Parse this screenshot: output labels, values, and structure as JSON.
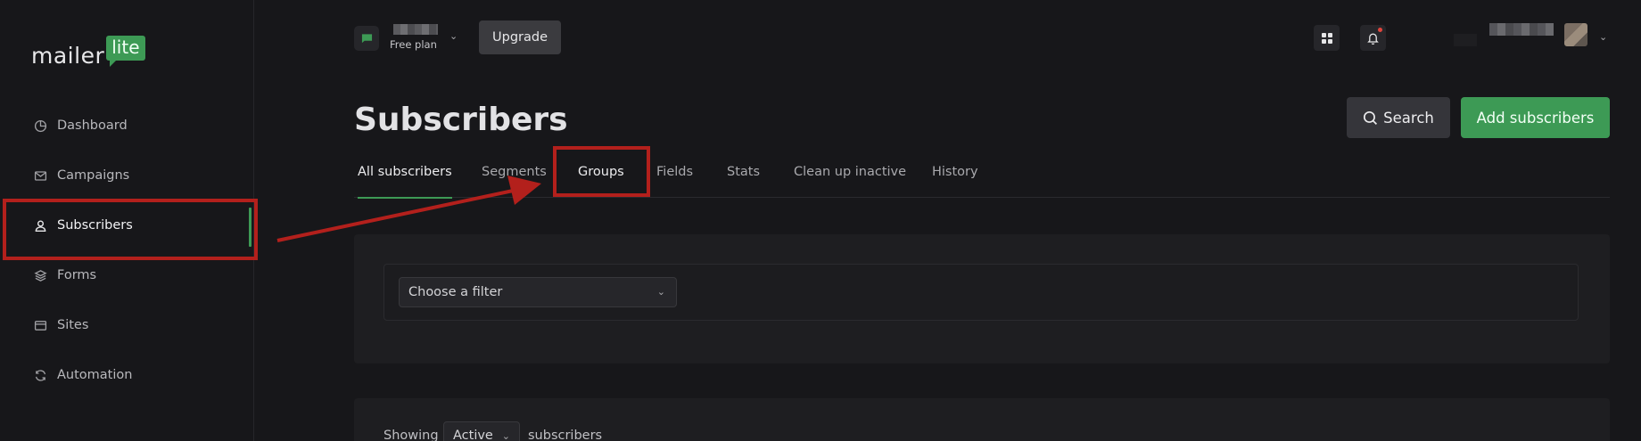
{
  "brand": {
    "word": "mailer",
    "badge": "lite",
    "accent": "#3d9a55"
  },
  "sidebar": {
    "items": [
      {
        "label": "Dashboard",
        "icon": "dashboard-icon"
      },
      {
        "label": "Campaigns",
        "icon": "mail-icon"
      },
      {
        "label": "Subscribers",
        "icon": "user-icon",
        "active": true
      },
      {
        "label": "Forms",
        "icon": "layers-icon"
      },
      {
        "label": "Sites",
        "icon": "browser-icon"
      },
      {
        "label": "Automation",
        "icon": "refresh-icon"
      }
    ]
  },
  "topbar": {
    "plan": "Free plan",
    "upgrade_label": "Upgrade"
  },
  "page": {
    "title": "Subscribers",
    "search_label": "Search",
    "add_label": "Add subscribers"
  },
  "tabs": [
    {
      "label": "All subscribers",
      "active": true
    },
    {
      "label": "Segments"
    },
    {
      "label": "Groups",
      "highlighted": true
    },
    {
      "label": "Fields"
    },
    {
      "label": "Stats"
    },
    {
      "label": "Clean up inactive"
    },
    {
      "label": "History"
    }
  ],
  "filter": {
    "placeholder": "Choose a filter"
  },
  "listing": {
    "prefix": "Showing",
    "status": "Active",
    "suffix": "subscribers"
  },
  "annotation_color": "#b3201c"
}
